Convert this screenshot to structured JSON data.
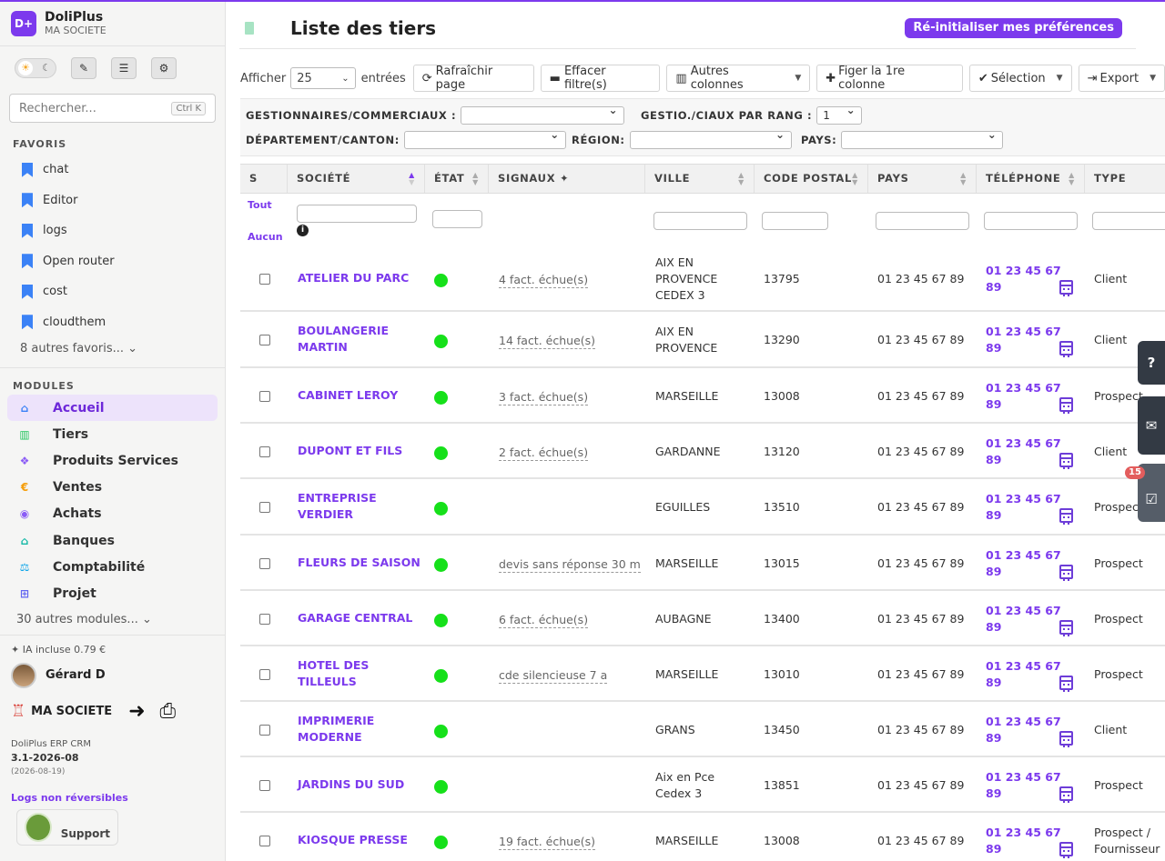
{
  "brand": {
    "logo": "D+",
    "name": "DoliPlus",
    "company": "MA SOCIETE"
  },
  "sidebar": {
    "search_placeholder": "Rechercher...",
    "search_shortcut": "Ctrl K",
    "favorites_title": "FAVORIS",
    "favorites": [
      {
        "label": "chat"
      },
      {
        "label": "Editor"
      },
      {
        "label": "logs"
      },
      {
        "label": "Open router"
      },
      {
        "label": "cost"
      },
      {
        "label": "cloudthem"
      }
    ],
    "favorites_more": "8 autres favoris... ⌄",
    "modules_title": "MODULES",
    "modules": [
      {
        "label": "Accueil",
        "icon": "home-icon",
        "color": "#3b82f6"
      },
      {
        "label": "Tiers",
        "icon": "building-icon",
        "color": "#22c55e"
      },
      {
        "label": "Produits Services",
        "icon": "cubes-icon",
        "color": "#8b5cf6"
      },
      {
        "label": "Ventes",
        "icon": "euro-icon",
        "color": "#f59e0b"
      },
      {
        "label": "Achats",
        "icon": "coins-icon",
        "color": "#8b5cf6"
      },
      {
        "label": "Banques",
        "icon": "bank-icon",
        "color": "#14b8a6"
      },
      {
        "label": "Comptabilité",
        "icon": "balance-icon",
        "color": "#0ea5e9"
      },
      {
        "label": "Projet",
        "icon": "sitemap-icon",
        "color": "#6366f1"
      }
    ],
    "modules_more": "30 autres modules... ⌄",
    "ia_label": "✦ IA incluse  0.79 €",
    "user_name": "Gérard D",
    "company_label": "MA SOCIETE",
    "version_product": "DoliPlus ERP CRM",
    "version": "3.1-2026-08",
    "version_date": "(2026-08-19)",
    "logs_label": "Logs non réversibles",
    "support_label": "Support"
  },
  "page": {
    "title": "Liste des tiers",
    "reset_button": "Ré-initialiser mes préférences",
    "show_label": "Afficher",
    "page_size": "25",
    "entries_label": "entrées",
    "refresh_button": "Rafraîchir page",
    "clear_filters_button": "Effacer filtre(s)",
    "other_columns_button": "Autres colonnes",
    "freeze_button": "Figer la 1re colonne",
    "selection_button": "Sélection",
    "export_button": "Export"
  },
  "filters": {
    "managers_label": "GESTIONNAIRES/COMMERCIAUX :",
    "rank_label": "GESTIO./CIAUX PAR RANG :",
    "rank_value": "1",
    "department_label": "DÉPARTEMENT/CANTON:",
    "region_label": "RÉGION:",
    "country_label": "PAYS:"
  },
  "table": {
    "columns": [
      "S",
      "SOCIÉTÉ",
      "ÉTAT",
      "SIGNAUX ✦",
      "VILLE",
      "CODE POSTAL",
      "PAYS",
      "TÉLÉPHONE",
      "TYPE"
    ],
    "select_all": "Tout",
    "select_none": "Aucun",
    "rows": [
      {
        "societe": "ATELIER DU PARC",
        "signal": "4 fact. échue(s)",
        "ville": "AIX EN PROVENCE CEDEX 3",
        "cp": "13795",
        "pays": "01 23 45 67 89",
        "tel": "01 23 45 67 89",
        "type": "Client"
      },
      {
        "societe": "BOULANGERIE MARTIN",
        "signal": "14 fact. échue(s)",
        "ville": "AIX EN PROVENCE",
        "cp": "13290",
        "pays": "01 23 45 67 89",
        "tel": "01 23 45 67 89",
        "type": "Client"
      },
      {
        "societe": "CABINET LEROY",
        "signal": "3 fact. échue(s)",
        "ville": "MARSEILLE",
        "cp": "13008",
        "pays": "01 23 45 67 89",
        "tel": "01 23 45 67 89",
        "type": "Prospect"
      },
      {
        "societe": "DUPONT ET FILS",
        "signal": "2 fact. échue(s)",
        "ville": "GARDANNE",
        "cp": "13120",
        "pays": "01 23 45 67 89",
        "tel": "01 23 45 67 89",
        "type": "Client"
      },
      {
        "societe": "ENTREPRISE VERDIER",
        "signal": "",
        "ville": "EGUILLES",
        "cp": "13510",
        "pays": "01 23 45 67 89",
        "tel": "01 23 45 67 89",
        "type": "Prospect"
      },
      {
        "societe": "FLEURS DE SAISON",
        "signal": "devis sans réponse 30 m",
        "ville": "MARSEILLE",
        "cp": "13015",
        "pays": "01 23 45 67 89",
        "tel": "01 23 45 67 89",
        "type": "Prospect"
      },
      {
        "societe": "GARAGE CENTRAL",
        "signal": "6 fact. échue(s)",
        "ville": "AUBAGNE",
        "cp": "13400",
        "pays": "01 23 45 67 89",
        "tel": "01 23 45 67 89",
        "type": "Prospect"
      },
      {
        "societe": "HOTEL DES TILLEULS",
        "signal": "cde silencieuse 7 a",
        "ville": "MARSEILLE",
        "cp": "13010",
        "pays": "01 23 45 67 89",
        "tel": "01 23 45 67 89",
        "type": "Prospect"
      },
      {
        "societe": "IMPRIMERIE MODERNE",
        "signal": "",
        "ville": "GRANS",
        "cp": "13450",
        "pays": "01 23 45 67 89",
        "tel": "01 23 45 67 89",
        "type": "Client"
      },
      {
        "societe": "JARDINS DU SUD",
        "signal": "",
        "ville": "Aix en Pce Cedex 3",
        "cp": "13851",
        "pays": "01 23 45 67 89",
        "tel": "01 23 45 67 89",
        "type": "Prospect"
      },
      {
        "societe": "KIOSQUE PRESSE",
        "signal": "19 fact. échue(s)",
        "ville": "MARSEILLE",
        "cp": "13008",
        "pays": "01 23 45 67 89",
        "tel": "01 23 45 67 89",
        "type": "Prospect / Fournisseur"
      }
    ]
  },
  "side_tabs": {
    "badge": "15"
  }
}
